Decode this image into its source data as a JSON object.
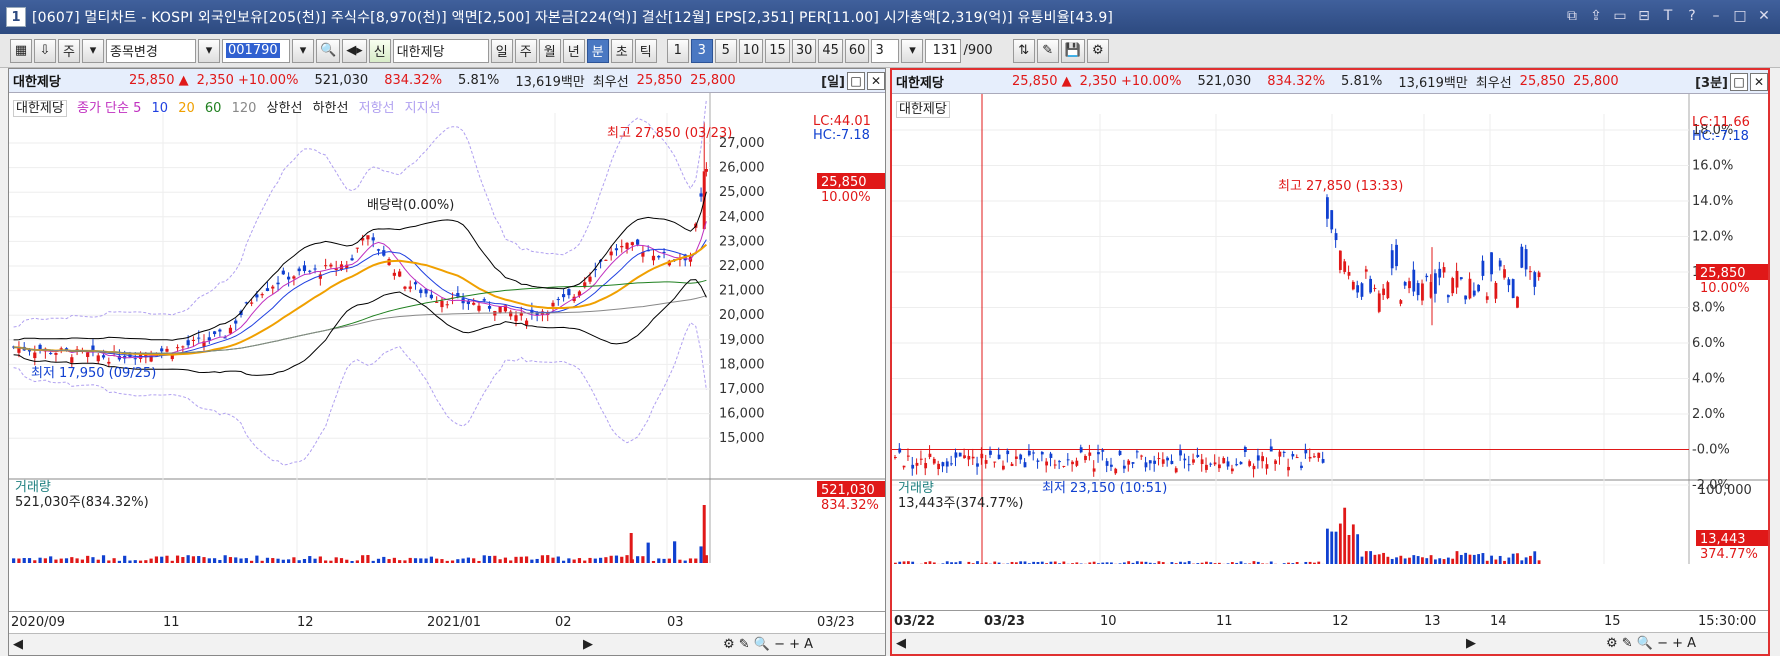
{
  "window": {
    "number": "1",
    "title": "[0607] 멀티차트 - KOSPI 외국인보유[205(천)] 주식수[8,970(천)] 액면[2,500] 자본금[224(억)] 결산[12월] EPS[2,351] PER[11.00] 시가총액[2,319(억)] 유통비율[43.9]"
  },
  "toolbar": {
    "type": "주",
    "search": "종목변경",
    "code": "001790",
    "new_badge": "신",
    "stock": "대한제당",
    "periods": [
      "일",
      "주",
      "월",
      "년",
      "분",
      "초",
      "틱"
    ],
    "selected_period": "분",
    "minutes": [
      "1",
      "3",
      "5",
      "10",
      "15",
      "30",
      "45",
      "60"
    ],
    "selected_minute": "3",
    "interval": "3",
    "count": "131",
    "total": "/900"
  },
  "left": {
    "info": {
      "name": "대한제당",
      "price": "25,850 ▲",
      "change": "2,350 +10.00%",
      "volume": "521,030",
      "vol_ratio": "834.32%",
      "turnover": "5.81%",
      "amount": "13,619백만",
      "pref_label": "최우선",
      "ask": "25,850",
      "bid": "25,800",
      "timeframe": "[일]"
    },
    "legend": {
      "stock": "대한제당",
      "ma_label": "종가 단순 5",
      "ma10": "10",
      "ma20": "20",
      "ma60": "60",
      "ma120": "120",
      "upper": "상한선",
      "lower": "하한선",
      "resistance": "저항선",
      "support": "지지선"
    },
    "lc": "LC:44.01",
    "hc": "HC:-7.18",
    "yticks": [
      "27,000",
      "26,000",
      "25,000",
      "24,000",
      "23,000",
      "22,000",
      "21,000",
      "20,000",
      "19,000",
      "18,000",
      "17,000",
      "16,000",
      "15,000"
    ],
    "price_tag": "25,850",
    "price_pct": "10.00%",
    "high_label": "최고 27,850 (03/23)",
    "low_label": "최저 17,950 (09/25)",
    "dividend_label": "배당락(0.00%)",
    "volume_title": "거래량",
    "volume_value": "521,030주(834.32%)",
    "vol_tag": "521,030",
    "vol_tag_pct": "834.32%",
    "xticks": [
      "2020/09",
      "11",
      "12",
      "2021/01",
      "02",
      "03"
    ],
    "last_date": "03/23"
  },
  "right": {
    "info": {
      "name": "대한제당",
      "price": "25,850 ▲",
      "change": "2,350 +10.00%",
      "volume": "521,030",
      "vol_ratio": "834.32%",
      "turnover": "5.81%",
      "amount": "13,619백만",
      "pref_label": "최우선",
      "ask": "25,850",
      "bid": "25,800",
      "timeframe": "[3분]"
    },
    "legend": {
      "stock": "대한제당"
    },
    "lc": "LC:11.66",
    "hc": "HC:-7.18",
    "yticks": [
      "18.0%",
      "16.0%",
      "14.0%",
      "12.0%",
      "10.0%",
      "8.0%",
      "6.0%",
      "4.0%",
      "2.0%",
      "-0.0%",
      "-2.0%"
    ],
    "price_tag": "25,850",
    "price_pct": "10.00%",
    "high_label": "최고 27,850 (13:33)",
    "low_label": "최저 23,150 (10:51)",
    "volume_title": "거래량",
    "volume_value": "13,443주(374.77%)",
    "vol_axis": "100,000",
    "vol_tag": "13,443",
    "vol_tag_pct": "374.77%",
    "xticks": [
      "03/22",
      "03/23",
      "10",
      "11",
      "12",
      "13",
      "14",
      "15"
    ],
    "last_time": "15:30:00"
  },
  "colors": {
    "up": "#e01818",
    "down": "#1040d0",
    "ma5": "#c030c0",
    "ma10": "#2040e0",
    "ma20": "#f0a000",
    "ma60": "#208020",
    "ma120": "#888888",
    "band": "#000000",
    "envelope": "#b0a0f0"
  }
}
